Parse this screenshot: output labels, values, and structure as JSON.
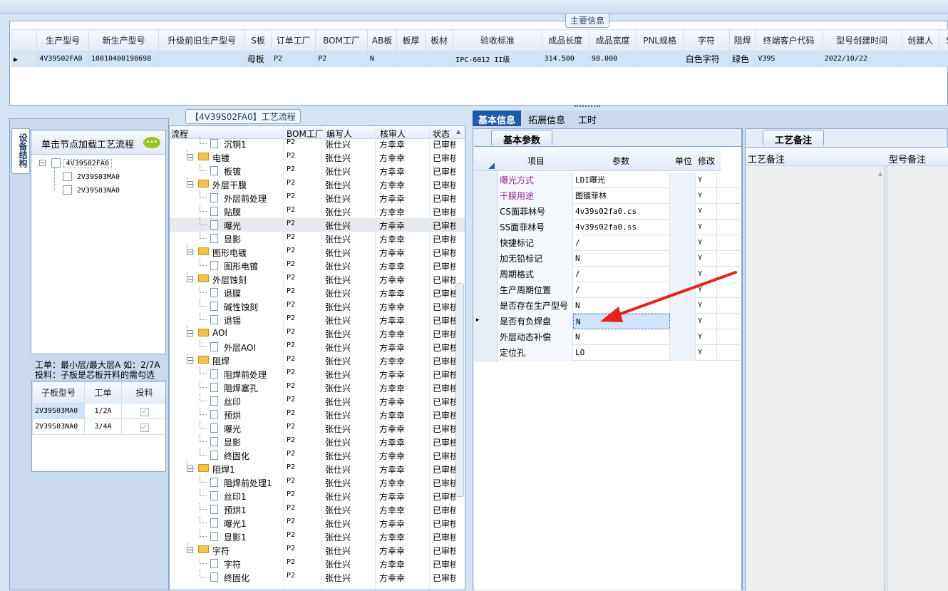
{
  "main_info": {
    "title": "主要信息",
    "columns": [
      "生产型号",
      "新生产型号",
      "升级前旧生产型号",
      "S板",
      "订单工厂",
      "BOM工厂",
      "AB板",
      "板厚",
      "板材",
      "验收标准",
      "成品长度",
      "成品宽度",
      "PNL规格",
      "字符",
      "阻焊",
      "终端客户代码",
      "型号创建时间",
      "创建人",
      "SO"
    ],
    "row": [
      "4V39S02FA0",
      "10010400198698",
      "",
      "母板",
      "P2",
      "P2",
      "N",
      "",
      "",
      "IPC-6012 II级",
      "314.500",
      "98.000",
      "",
      "白色字符",
      "绿色",
      "V39S",
      "2022/10/22",
      "",
      ""
    ]
  },
  "left_panel": {
    "vertical_tab": "设备结构",
    "load_hint": "单击节点加载工艺流程",
    "tree": [
      "4V39S02FA0",
      "2V39S03MA0",
      "2V39S03NA0"
    ],
    "note1": "工单：最小层/最大层A 如：2/7A",
    "note2": "投料：子板是芯板开料的需勾选",
    "sub_columns": [
      "子板型号",
      "工单",
      "投料"
    ],
    "sub_rows": [
      {
        "model": "2V39S03MA0",
        "order": "1/2A"
      },
      {
        "model": "2V39S03NA0",
        "order": "3/4A"
      }
    ]
  },
  "flow_panel": {
    "title": "【4V39S02FA0】工艺流程",
    "columns": [
      "流程",
      "BOM工厂",
      "编写人",
      "核审人",
      "状态"
    ],
    "bom": "P2",
    "writer": "张仕兴",
    "reviewer": "方幸幸",
    "status": "已审核",
    "rows": [
      {
        "name": "沉铜1",
        "type": "file"
      },
      {
        "name": "电镀",
        "type": "folder"
      },
      {
        "name": "板镀",
        "type": "file"
      },
      {
        "name": "外层干膜",
        "type": "folder"
      },
      {
        "name": "外层前处理",
        "type": "file"
      },
      {
        "name": "贴膜",
        "type": "file"
      },
      {
        "name": "曝光",
        "type": "file"
      },
      {
        "name": "显影",
        "type": "file"
      },
      {
        "name": "图形电镀",
        "type": "folder"
      },
      {
        "name": "图形电镀",
        "type": "file"
      },
      {
        "name": "外层蚀刻",
        "type": "folder"
      },
      {
        "name": "退膜",
        "type": "file"
      },
      {
        "name": "碱性蚀刻",
        "type": "file"
      },
      {
        "name": "退锡",
        "type": "file"
      },
      {
        "name": "AOI",
        "type": "folder"
      },
      {
        "name": "外层AOI",
        "type": "file"
      },
      {
        "name": "阻焊",
        "type": "folder"
      },
      {
        "name": "阻焊前处理",
        "type": "file"
      },
      {
        "name": "阻焊塞孔",
        "type": "file"
      },
      {
        "name": "丝印",
        "type": "file"
      },
      {
        "name": "预烘",
        "type": "file"
      },
      {
        "name": "曝光",
        "type": "file"
      },
      {
        "name": "显影",
        "type": "file"
      },
      {
        "name": "终固化",
        "type": "file"
      },
      {
        "name": "阻焊1",
        "type": "folder"
      },
      {
        "name": "阻焊前处理1",
        "type": "file"
      },
      {
        "name": "丝印1",
        "type": "file"
      },
      {
        "name": "预烘1",
        "type": "file"
      },
      {
        "name": "曝光1",
        "type": "file"
      },
      {
        "name": "显影1",
        "type": "file"
      },
      {
        "name": "字符",
        "type": "folder"
      },
      {
        "name": "字符",
        "type": "file"
      },
      {
        "name": "终固化",
        "type": "file"
      }
    ]
  },
  "right_tabs": [
    "基本信息",
    "拓展信息",
    "工时"
  ],
  "basic_params": {
    "subtab": "基本参数",
    "columns": [
      "项目",
      "参数",
      "单位",
      "修改"
    ],
    "rows": [
      {
        "item": "曝光方式",
        "value": "LDI曝光",
        "unit": "",
        "mod": "Y",
        "highlight": true
      },
      {
        "item": "干膜用途",
        "value": "图镀菲林",
        "unit": "",
        "mod": "Y",
        "highlight": true
      },
      {
        "item": "CS面菲林号",
        "value": "4v39s02fa0.cs",
        "unit": "",
        "mod": "Y",
        "highlight": false
      },
      {
        "item": "SS面菲林号",
        "value": "4v39s02fa0.ss",
        "unit": "",
        "mod": "Y",
        "highlight": false
      },
      {
        "item": "快捷标记",
        "value": "/",
        "unit": "",
        "mod": "Y",
        "highlight": false
      },
      {
        "item": "加无铅标记",
        "value": "N",
        "unit": "",
        "mod": "Y",
        "highlight": false
      },
      {
        "item": "周期格式",
        "value": "/",
        "unit": "",
        "mod": "Y",
        "highlight": false
      },
      {
        "item": "生产周期位置",
        "value": "/",
        "unit": "",
        "mod": "Y",
        "highlight": false
      },
      {
        "item": "是否存在生产型号",
        "value": "N",
        "unit": "",
        "mod": "Y",
        "highlight": false
      },
      {
        "item": "是否有负焊盘",
        "value": "N",
        "unit": "",
        "mod": "Y",
        "highlight": false
      },
      {
        "item": "外层动态补偿",
        "value": "N",
        "unit": "",
        "mod": "Y",
        "highlight": false
      },
      {
        "item": "定位孔",
        "value": "LO",
        "unit": "",
        "mod": "Y",
        "highlight": false
      }
    ]
  },
  "remarks": {
    "subtab": "工艺备注",
    "col1": "工艺备注",
    "col2": "型号备注"
  },
  "colors": {
    "accent": "#1e5aa8",
    "highlight_text": "#9b2a8a",
    "arrow": "#e8211c"
  }
}
